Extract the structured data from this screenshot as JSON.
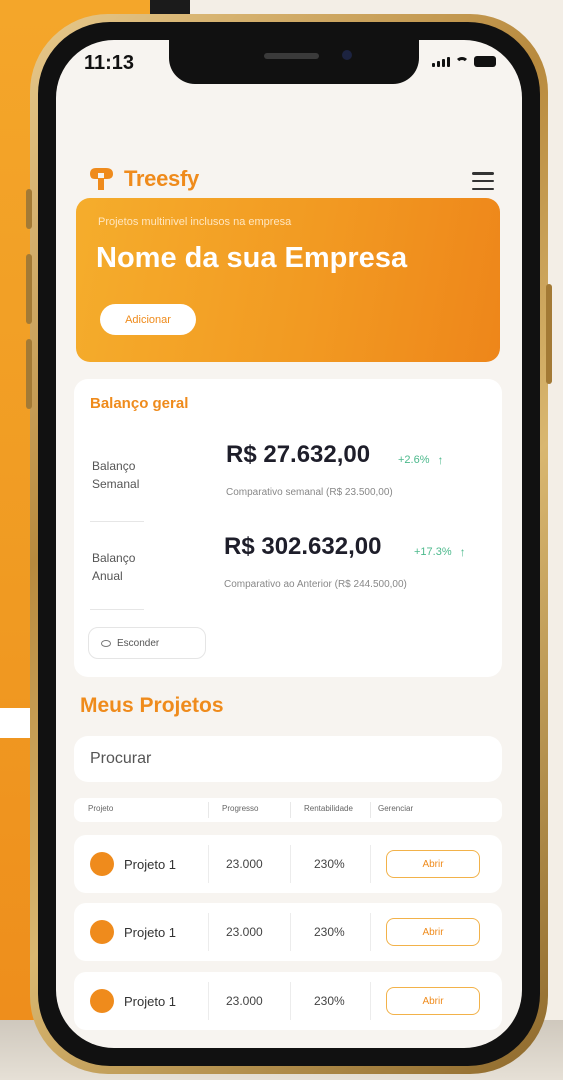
{
  "status_bar": {
    "time": "11:13"
  },
  "header": {
    "brand": "Treesfy"
  },
  "hero": {
    "subtitle": "Projetos multinivel inclusos na empresa",
    "title": "Nome da sua Empresa",
    "button_label": "Adicionar"
  },
  "balance": {
    "title": "Balanço geral",
    "rows": [
      {
        "label": "Balanço Semanal",
        "value": "R$ 27.632,00",
        "change": "+2.6%",
        "compare": "Comparativo semanal (R$ 23.500,00)"
      },
      {
        "label": "Balanço Anual",
        "value": "R$ 302.632,00",
        "change": "+17.3%",
        "compare": "Comparativo ao Anterior (R$ 244.500,00)"
      }
    ],
    "hide_label": "Esconder"
  },
  "projects": {
    "title": "Meus Projetos",
    "search_placeholder": "Procurar",
    "columns": [
      "Projeto",
      "Progresso",
      "Rentabilidade",
      "Gerenciar"
    ],
    "rows": [
      {
        "name": "Projeto 1",
        "value": "23.000",
        "percent": "230%",
        "action": "Abrir"
      },
      {
        "name": "Projeto 1",
        "value": "23.000",
        "percent": "230%",
        "action": "Abrir"
      },
      {
        "name": "Projeto 1",
        "value": "23.000",
        "percent": "230%",
        "action": "Abrir"
      }
    ]
  },
  "colors": {
    "accent": "#ef8b1c",
    "positive": "#4cb98c",
    "text_dark": "#1e1e2a"
  },
  "icons": [
    "treesfy-logo-icon",
    "hamburger-menu-icon",
    "arrow-up-icon",
    "eye-icon",
    "signal-icon",
    "wifi-icon",
    "battery-icon"
  ]
}
